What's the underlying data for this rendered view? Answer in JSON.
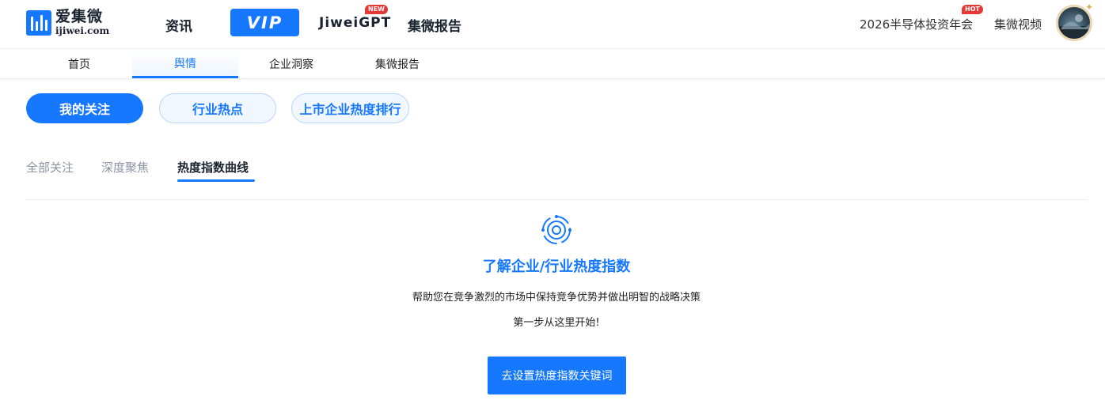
{
  "header": {
    "logo": {
      "name_cn": "爱集微",
      "domain": "ijiwei.com"
    },
    "nav": {
      "news": "资讯",
      "vip": "VIP",
      "gpt": "JiweiGPT",
      "gpt_badge": "NEW",
      "report": "集微报告"
    },
    "right": {
      "event": "2026半导体投资年会",
      "event_badge": "HOT",
      "video": "集微视频"
    }
  },
  "subnav": {
    "items": [
      {
        "label": "首页",
        "active": false
      },
      {
        "label": "舆情",
        "active": true
      },
      {
        "label": "企业洞察",
        "active": false
      },
      {
        "label": "集微报告",
        "active": false
      }
    ]
  },
  "pills": {
    "items": [
      {
        "label": "我的关注",
        "active": true
      },
      {
        "label": "行业热点",
        "active": false
      },
      {
        "label": "上市企业热度排行",
        "active": false
      }
    ]
  },
  "tabs": {
    "items": [
      {
        "label": "全部关注",
        "active": false
      },
      {
        "label": "深度聚焦",
        "active": false
      },
      {
        "label": "热度指数曲线",
        "active": true
      }
    ]
  },
  "empty_state": {
    "icon": "target-icon",
    "title": "了解企业/行业热度指数",
    "line1": "帮助您在竞争激烈的市场中保持竞争优势并做出明智的战略决策",
    "line2": "第一步从这里开始!",
    "button": "去设置热度指数关键词"
  },
  "colors": {
    "accent": "#1677ff",
    "badge": "#e53935"
  }
}
